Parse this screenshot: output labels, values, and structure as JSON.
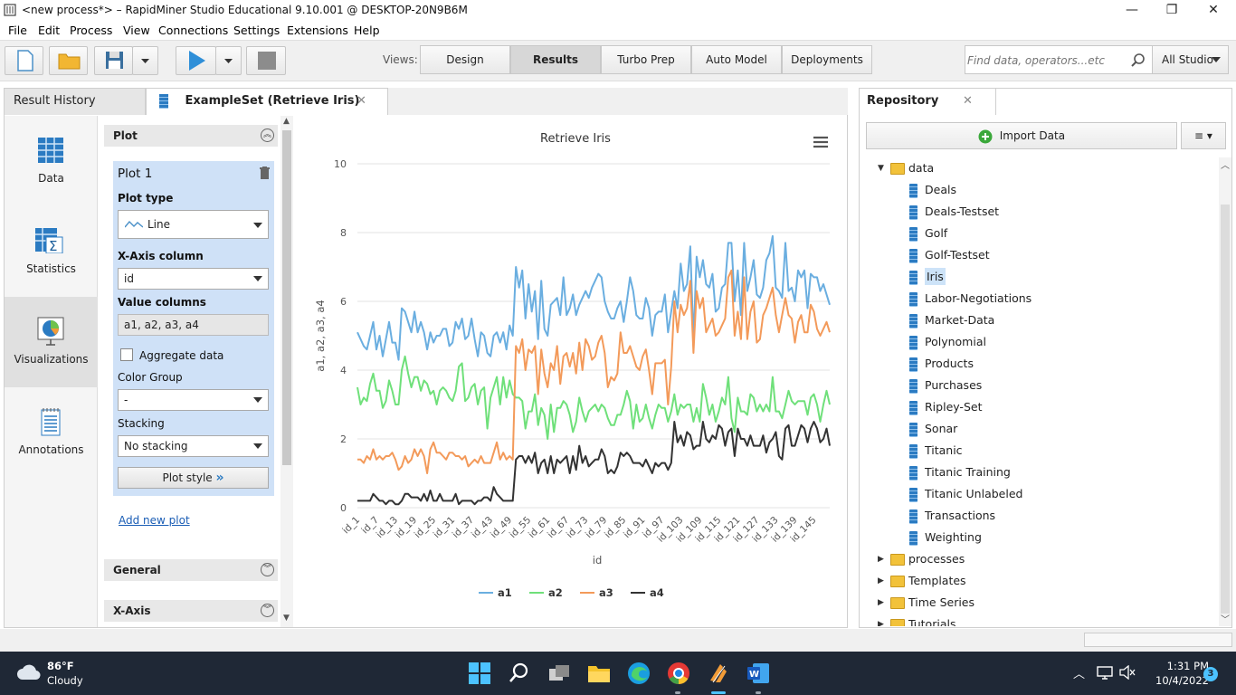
{
  "window": {
    "title": "<new process*> – RapidMiner Studio Educational 9.10.001 @ DESKTOP-20N9B6M",
    "minimize": "—",
    "restore": "❐",
    "close": "✕"
  },
  "menu": [
    "File",
    "Edit",
    "Process",
    "View",
    "Connections",
    "Settings",
    "Extensions",
    "Help"
  ],
  "toolbar": {
    "views_label": "Views:",
    "views": [
      "Design",
      "Results",
      "Turbo Prep",
      "Auto Model",
      "Deployments"
    ],
    "active_view": "Results",
    "search_placeholder": "Find data, operators...etc",
    "scope": "All Studio"
  },
  "tabs": {
    "result_history": "Result History",
    "example_set": "ExampleSet (Retrieve Iris)",
    "close": "✕"
  },
  "sidenav": [
    "Data",
    "Statistics",
    "Visualizations",
    "Annotations"
  ],
  "plot_config": {
    "section_plot": "Plot",
    "plot_name": "Plot 1",
    "plot_type_label": "Plot type",
    "plot_type": "Line",
    "x_axis_label": "X-Axis column",
    "x_axis": "id",
    "value_columns_label": "Value columns",
    "value_columns": "a1, a2, a3, a4",
    "aggregate_label": "Aggregate data",
    "color_group_label": "Color Group",
    "color_group": "-",
    "stacking_label": "Stacking",
    "stacking": "No stacking",
    "plot_style": "Plot style",
    "add_new_plot": "Add new plot",
    "section_general": "General",
    "section_xaxis": "X-Axis"
  },
  "chart_data": {
    "type": "line",
    "title": "Retrieve Iris",
    "xlabel": "id",
    "ylabel": "a1, a2, a3, a4",
    "ylim": [
      0,
      10
    ],
    "yticks": [
      0,
      2,
      4,
      6,
      8,
      10
    ],
    "x_tick_labels": [
      "id_1",
      "id_7",
      "id_13",
      "id_19",
      "id_25",
      "id_31",
      "id_37",
      "id_43",
      "id_49",
      "id_55",
      "id_61",
      "id_67",
      "id_73",
      "id_79",
      "id_85",
      "id_91",
      "id_97",
      "id_103",
      "id_109",
      "id_115",
      "id_121",
      "id_127",
      "id_133",
      "id_139",
      "id_145"
    ],
    "legend_position": "bottom",
    "colors": {
      "a1": "#6aaee0",
      "a2": "#6fe07a",
      "a3": "#f39a5a",
      "a4": "#333333"
    },
    "series": [
      {
        "name": "a1",
        "values": [
          5.1,
          4.9,
          4.7,
          4.6,
          5.0,
          5.4,
          4.6,
          5.0,
          4.4,
          4.9,
          5.4,
          4.8,
          4.8,
          4.3,
          5.8,
          5.7,
          5.4,
          5.1,
          5.7,
          5.1,
          5.4,
          5.1,
          4.6,
          5.1,
          4.8,
          5.0,
          5.0,
          5.2,
          5.2,
          4.7,
          4.8,
          5.4,
          5.2,
          5.5,
          4.9,
          5.0,
          5.5,
          4.9,
          4.4,
          5.1,
          5.0,
          4.5,
          4.4,
          5.0,
          5.1,
          4.8,
          5.1,
          4.6,
          5.3,
          5.0,
          7.0,
          6.4,
          6.9,
          5.5,
          6.5,
          5.7,
          6.3,
          4.9,
          6.6,
          5.2,
          5.0,
          5.9,
          6.0,
          6.1,
          5.6,
          6.7,
          5.6,
          5.8,
          6.2,
          5.6,
          5.9,
          6.1,
          6.3,
          6.1,
          6.4,
          6.6,
          6.8,
          6.7,
          6.0,
          5.7,
          5.5,
          5.5,
          5.8,
          6.0,
          5.4,
          6.0,
          6.7,
          6.3,
          5.6,
          5.5,
          5.5,
          6.1,
          5.8,
          5.0,
          5.6,
          5.7,
          5.7,
          6.2,
          5.1,
          5.7,
          6.3,
          5.8,
          7.1,
          6.3,
          6.5,
          7.6,
          4.9,
          7.3,
          6.7,
          7.2,
          6.5,
          6.4,
          6.8,
          5.7,
          5.8,
          6.4,
          6.5,
          7.7,
          7.7,
          6.0,
          6.9,
          5.6,
          7.7,
          6.3,
          6.7,
          7.2,
          6.2,
          6.1,
          6.4,
          7.2,
          7.4,
          7.9,
          6.4,
          6.3,
          6.1,
          7.7,
          6.3,
          6.4,
          6.0,
          6.9,
          6.7,
          6.9,
          5.8,
          6.8,
          6.7,
          6.7,
          6.3,
          6.5,
          6.2,
          5.9
        ]
      },
      {
        "name": "a2",
        "values": [
          3.5,
          3.0,
          3.2,
          3.1,
          3.6,
          3.9,
          3.4,
          3.4,
          2.9,
          3.1,
          3.7,
          3.4,
          3.0,
          3.0,
          4.0,
          4.4,
          3.9,
          3.5,
          3.8,
          3.8,
          3.4,
          3.7,
          3.6,
          3.3,
          3.4,
          3.0,
          3.4,
          3.5,
          3.4,
          3.2,
          3.1,
          3.4,
          4.1,
          4.2,
          3.1,
          3.2,
          3.5,
          3.6,
          3.0,
          3.4,
          3.5,
          2.3,
          3.2,
          3.5,
          3.8,
          3.0,
          3.8,
          3.2,
          3.7,
          3.3,
          3.2,
          3.2,
          3.1,
          2.3,
          2.8,
          2.8,
          3.3,
          2.4,
          2.9,
          2.7,
          2.0,
          3.0,
          2.2,
          2.9,
          2.9,
          3.1,
          3.0,
          2.7,
          2.2,
          2.5,
          3.2,
          2.8,
          2.5,
          2.8,
          2.9,
          3.0,
          2.8,
          3.0,
          2.9,
          2.6,
          2.4,
          2.4,
          2.7,
          2.7,
          3.0,
          3.4,
          3.1,
          2.3,
          3.0,
          2.5,
          2.6,
          3.0,
          2.6,
          2.3,
          2.7,
          3.0,
          2.9,
          2.9,
          2.5,
          2.8,
          3.3,
          2.7,
          3.0,
          2.9,
          3.0,
          3.0,
          2.5,
          2.9,
          2.5,
          3.6,
          3.2,
          2.7,
          3.0,
          2.5,
          2.8,
          3.2,
          3.0,
          3.8,
          2.6,
          2.2,
          3.2,
          2.8,
          2.8,
          2.7,
          3.3,
          3.2,
          2.8,
          3.0,
          2.8,
          3.0,
          2.8,
          3.8,
          2.8,
          2.8,
          2.6,
          3.0,
          3.4,
          3.1,
          3.0,
          3.1,
          3.1,
          3.1,
          2.7,
          3.2,
          3.3,
          3.0,
          2.5,
          3.0,
          3.4,
          3.0
        ]
      },
      {
        "name": "a3",
        "values": [
          1.4,
          1.4,
          1.3,
          1.5,
          1.4,
          1.7,
          1.4,
          1.5,
          1.4,
          1.5,
          1.5,
          1.6,
          1.4,
          1.1,
          1.2,
          1.5,
          1.3,
          1.4,
          1.7,
          1.5,
          1.7,
          1.5,
          1.0,
          1.7,
          1.9,
          1.6,
          1.6,
          1.5,
          1.4,
          1.6,
          1.6,
          1.5,
          1.5,
          1.4,
          1.5,
          1.2,
          1.3,
          1.4,
          1.3,
          1.5,
          1.3,
          1.3,
          1.3,
          1.6,
          1.9,
          1.4,
          1.6,
          1.4,
          1.5,
          1.4,
          4.7,
          4.5,
          4.9,
          4.0,
          4.6,
          4.5,
          4.7,
          3.3,
          4.6,
          3.9,
          3.5,
          4.2,
          4.0,
          4.7,
          3.6,
          4.4,
          4.5,
          4.1,
          4.5,
          3.9,
          4.8,
          4.0,
          4.9,
          4.7,
          4.3,
          4.4,
          4.8,
          5.0,
          4.5,
          3.5,
          3.8,
          3.7,
          3.9,
          5.1,
          4.5,
          4.5,
          4.7,
          4.4,
          4.1,
          4.0,
          4.4,
          4.6,
          4.0,
          3.3,
          4.2,
          4.2,
          4.2,
          4.3,
          3.0,
          4.1,
          6.0,
          5.1,
          5.9,
          5.6,
          5.8,
          6.6,
          4.5,
          6.3,
          5.8,
          6.1,
          5.1,
          5.3,
          5.5,
          5.0,
          5.1,
          5.3,
          5.5,
          6.7,
          6.9,
          5.0,
          5.7,
          4.9,
          6.7,
          4.9,
          5.7,
          6.0,
          4.8,
          4.9,
          5.6,
          5.8,
          6.1,
          6.4,
          5.6,
          5.1,
          5.6,
          6.1,
          5.6,
          5.5,
          4.8,
          5.4,
          5.6,
          5.1,
          5.1,
          5.9,
          5.7,
          5.2,
          5.0,
          5.2,
          5.4,
          5.1
        ]
      },
      {
        "name": "a4",
        "values": [
          0.2,
          0.2,
          0.2,
          0.2,
          0.2,
          0.4,
          0.3,
          0.2,
          0.2,
          0.1,
          0.2,
          0.2,
          0.1,
          0.1,
          0.2,
          0.4,
          0.4,
          0.3,
          0.3,
          0.3,
          0.2,
          0.4,
          0.2,
          0.5,
          0.2,
          0.2,
          0.4,
          0.2,
          0.2,
          0.2,
          0.2,
          0.4,
          0.1,
          0.2,
          0.2,
          0.2,
          0.2,
          0.1,
          0.2,
          0.2,
          0.3,
          0.3,
          0.2,
          0.6,
          0.4,
          0.3,
          0.2,
          0.2,
          0.2,
          0.2,
          1.4,
          1.5,
          1.5,
          1.3,
          1.5,
          1.3,
          1.6,
          1.0,
          1.3,
          1.4,
          1.0,
          1.5,
          1.0,
          1.4,
          1.3,
          1.4,
          1.5,
          1.0,
          1.5,
          1.1,
          1.8,
          1.3,
          1.5,
          1.2,
          1.3,
          1.4,
          1.4,
          1.7,
          1.5,
          1.0,
          1.1,
          1.0,
          1.2,
          1.6,
          1.5,
          1.6,
          1.5,
          1.3,
          1.3,
          1.3,
          1.2,
          1.4,
          1.2,
          1.0,
          1.3,
          1.2,
          1.3,
          1.3,
          1.1,
          1.3,
          2.5,
          1.9,
          2.1,
          1.8,
          2.2,
          2.1,
          1.7,
          1.8,
          1.8,
          2.5,
          2.0,
          1.9,
          2.1,
          2.0,
          2.4,
          2.3,
          1.8,
          2.2,
          2.3,
          1.5,
          2.3,
          2.0,
          2.0,
          1.8,
          2.1,
          1.8,
          1.8,
          1.8,
          2.1,
          1.6,
          1.9,
          2.0,
          2.2,
          1.5,
          1.4,
          2.3,
          2.4,
          1.8,
          1.8,
          2.1,
          2.4,
          2.3,
          1.9,
          2.3,
          2.5,
          2.3,
          1.9,
          2.0,
          2.3,
          1.8
        ]
      }
    ]
  },
  "repository": {
    "tab": "Repository",
    "close": "✕",
    "import": "Import Data",
    "menu": "≡ ▾",
    "tree": [
      {
        "label": "data",
        "type": "folder",
        "expanded": true,
        "level": 0
      },
      {
        "label": "Deals",
        "type": "data",
        "level": 1
      },
      {
        "label": "Deals-Testset",
        "type": "data",
        "level": 1
      },
      {
        "label": "Golf",
        "type": "data",
        "level": 1
      },
      {
        "label": "Golf-Testset",
        "type": "data",
        "level": 1
      },
      {
        "label": "Iris",
        "type": "data",
        "level": 1,
        "selected": true
      },
      {
        "label": "Labor-Negotiations",
        "type": "data",
        "level": 1
      },
      {
        "label": "Market-Data",
        "type": "data",
        "level": 1
      },
      {
        "label": "Polynomial",
        "type": "data",
        "level": 1
      },
      {
        "label": "Products",
        "type": "data",
        "level": 1
      },
      {
        "label": "Purchases",
        "type": "data",
        "level": 1
      },
      {
        "label": "Ripley-Set",
        "type": "data",
        "level": 1
      },
      {
        "label": "Sonar",
        "type": "data",
        "level": 1
      },
      {
        "label": "Titanic",
        "type": "data",
        "level": 1
      },
      {
        "label": "Titanic Training",
        "type": "data",
        "level": 1
      },
      {
        "label": "Titanic Unlabeled",
        "type": "data",
        "level": 1
      },
      {
        "label": "Transactions",
        "type": "data",
        "level": 1
      },
      {
        "label": "Weighting",
        "type": "data",
        "level": 1
      },
      {
        "label": "processes",
        "type": "folder",
        "expanded": false,
        "level": 0
      },
      {
        "label": "Templates",
        "type": "folder",
        "expanded": false,
        "level": 0
      },
      {
        "label": "Time Series",
        "type": "folder",
        "expanded": false,
        "level": 0
      },
      {
        "label": "Tutorials",
        "type": "folder",
        "expanded": false,
        "level": 0
      }
    ]
  },
  "taskbar": {
    "weather_temp": "86°F",
    "weather_desc": "Cloudy",
    "time": "1:31 PM",
    "date": "10/4/2022",
    "notif_count": "3"
  }
}
